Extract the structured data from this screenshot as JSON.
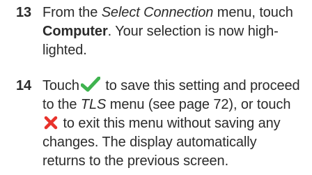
{
  "steps": [
    {
      "number": "13",
      "line1": {
        "a": "From the ",
        "menu": "Select Connection",
        "b": " menu,",
        "c": " touch"
      },
      "line2": {
        "bold": "Computer",
        "rest": ". Your selection is now high-"
      },
      "line3": "lighted."
    },
    {
      "number": "14",
      "line1": {
        "a": "Touch",
        "b": " to save this setting and proceed"
      },
      "line2": {
        "a": "to the ",
        "menu": "TLS",
        "b": " menu (see page 72), or touch"
      },
      "line3": " to exit this menu without saving any",
      "line4": "changes. The display automatically",
      "line5": "returns to the previous screen."
    }
  ],
  "icons": {
    "confirm": {
      "name": "checkmark-icon",
      "color": "#3fb34f"
    },
    "cancel": {
      "name": "x-icon",
      "color": "#e8322b"
    }
  }
}
